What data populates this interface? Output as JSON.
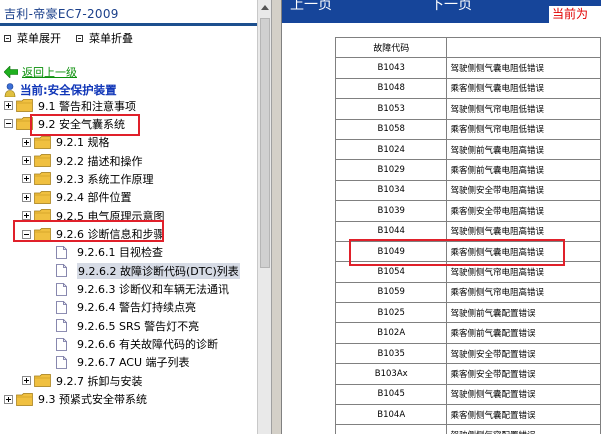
{
  "sidebar": {
    "title": "吉利-帝豪EC7-2009",
    "expand_all": "菜单展开",
    "collapse_all": "菜单折叠",
    "back_link": "返回上一级",
    "current_label": "当前:安全保护装置",
    "tree": [
      {
        "label": "9.1 警告和注意事项",
        "type": "folder",
        "toggle": "plus",
        "level": 0
      },
      {
        "label": "9.2 安全气囊系统",
        "type": "folder",
        "toggle": "minus",
        "level": 0
      },
      {
        "label": "9.2.1 规格",
        "type": "folder",
        "toggle": "plus",
        "level": 1
      },
      {
        "label": "9.2.2 描述和操作",
        "type": "folder",
        "toggle": "plus",
        "level": 1
      },
      {
        "label": "9.2.3 系统工作原理",
        "type": "folder",
        "toggle": "plus",
        "level": 1
      },
      {
        "label": "9.2.4 部件位置",
        "type": "folder",
        "toggle": "plus",
        "level": 1
      },
      {
        "label": "9.2.5 电气原理示意图",
        "type": "folder",
        "toggle": "plus",
        "level": 1
      },
      {
        "label": "9.2.6 诊断信息和步骤",
        "type": "folder",
        "toggle": "minus",
        "level": 1
      },
      {
        "label": "9.2.6.1 目视检查",
        "type": "doc",
        "level": 2
      },
      {
        "label": "9.2.6.2 故障诊断代码(DTC)列表",
        "type": "doc",
        "level": 2,
        "selected": true
      },
      {
        "label": "9.2.6.3 诊断仪和车辆无法通讯",
        "type": "doc",
        "level": 2
      },
      {
        "label": "9.2.6.4 警告灯持续点亮",
        "type": "doc",
        "level": 2
      },
      {
        "label": "9.2.6.5 SRS 警告灯不亮",
        "type": "doc",
        "level": 2
      },
      {
        "label": "9.2.6.6 有关故障代码的诊断",
        "type": "doc",
        "level": 2
      },
      {
        "label": "9.2.6.7 ACU 端子列表",
        "type": "doc",
        "level": 2
      },
      {
        "label": "9.2.7 拆卸与安装",
        "type": "folder",
        "toggle": "plus",
        "level": 1
      },
      {
        "label": "9.3 预紧式安全带系统",
        "type": "folder",
        "toggle": "plus",
        "level": 0
      }
    ]
  },
  "content": {
    "prev_label": "上一页",
    "next_label": "下一页",
    "current_tab": "当前为",
    "table_header": "故障代码",
    "rows": [
      {
        "code": "B1043",
        "desc": "驾驶侧侧气囊电阻低错误"
      },
      {
        "code": "B1048",
        "desc": "乘客侧侧气囊电阻低错误"
      },
      {
        "code": "B1053",
        "desc": "驾驶侧侧气帘电阻低错误"
      },
      {
        "code": "B1058",
        "desc": "乘客侧侧气帘电阻低错误"
      },
      {
        "code": "B1024",
        "desc": "驾驶侧前气囊电阻高错误"
      },
      {
        "code": "B1029",
        "desc": "乘客侧前气囊电阻高错误"
      },
      {
        "code": "B1034",
        "desc": "驾驶侧安全带电阻高错误"
      },
      {
        "code": "B1039",
        "desc": "乘客侧安全带电阻高错误"
      },
      {
        "code": "B1044",
        "desc": "驾驶侧侧气囊电阻高错误"
      },
      {
        "code": "B1049",
        "desc": "乘客侧侧气囊电阻高错误"
      },
      {
        "code": "B1054",
        "desc": "驾驶侧侧气帘电阻高错误"
      },
      {
        "code": "B1059",
        "desc": "乘客侧侧气帘电阻高错误"
      },
      {
        "code": "B1025",
        "desc": "驾驶侧前气囊配置错误"
      },
      {
        "code": "B102A",
        "desc": "乘客侧前气囊配置错误"
      },
      {
        "code": "B1035",
        "desc": "驾驶侧安全带配置错误"
      },
      {
        "code": "B103Ax",
        "desc": "乘客侧安全带配置错误"
      },
      {
        "code": "B1045",
        "desc": "驾驶侧侧气囊配置错误"
      },
      {
        "code": "B104A",
        "desc": "乘客侧侧气囊配置错误"
      },
      {
        "code": "",
        "desc": "驾驶侧侧气帘配置错误"
      }
    ]
  },
  "colors": {
    "title_underline": "#1c4f8e",
    "topbar": "#16459a",
    "highlight_box": "#e0202a",
    "back_link": "#0a8f0a",
    "current_label": "#1036b8"
  }
}
